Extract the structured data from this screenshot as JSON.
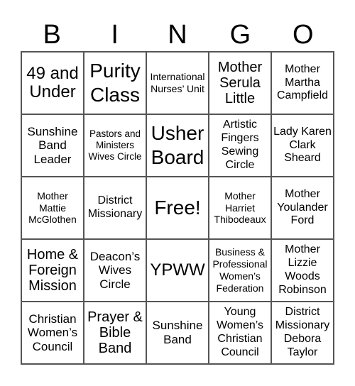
{
  "header": {
    "letters": [
      "B",
      "I",
      "N",
      "G",
      "O"
    ]
  },
  "cells": [
    "49 and Under",
    "Purity Class",
    "International Nurses’ Unit",
    "Mother Serula Little",
    "Mother Martha Campfield",
    "Sunshine Band Leader",
    "Pastors and Ministers Wives Circle",
    "Usher Board",
    "Artistic Fingers Sewing Circle",
    "Lady Karen Clark Sheard",
    "Mother Mattie McGlothen",
    "District Missionary",
    "Free!",
    "Mother Harriet Thibodeaux",
    "Mother Youlander Ford",
    "Home & Foreign Mission",
    "Deacon’s Wives Circle",
    "YPWW",
    "Business & Professional Women’s Federation",
    "Mother Lizzie Woods Robinson",
    "Christian Women’s Council",
    "Prayer & Bible Band",
    "Sunshine Band",
    "Young Women’s Christian Council",
    "District Missionary Debora Taylor"
  ]
}
